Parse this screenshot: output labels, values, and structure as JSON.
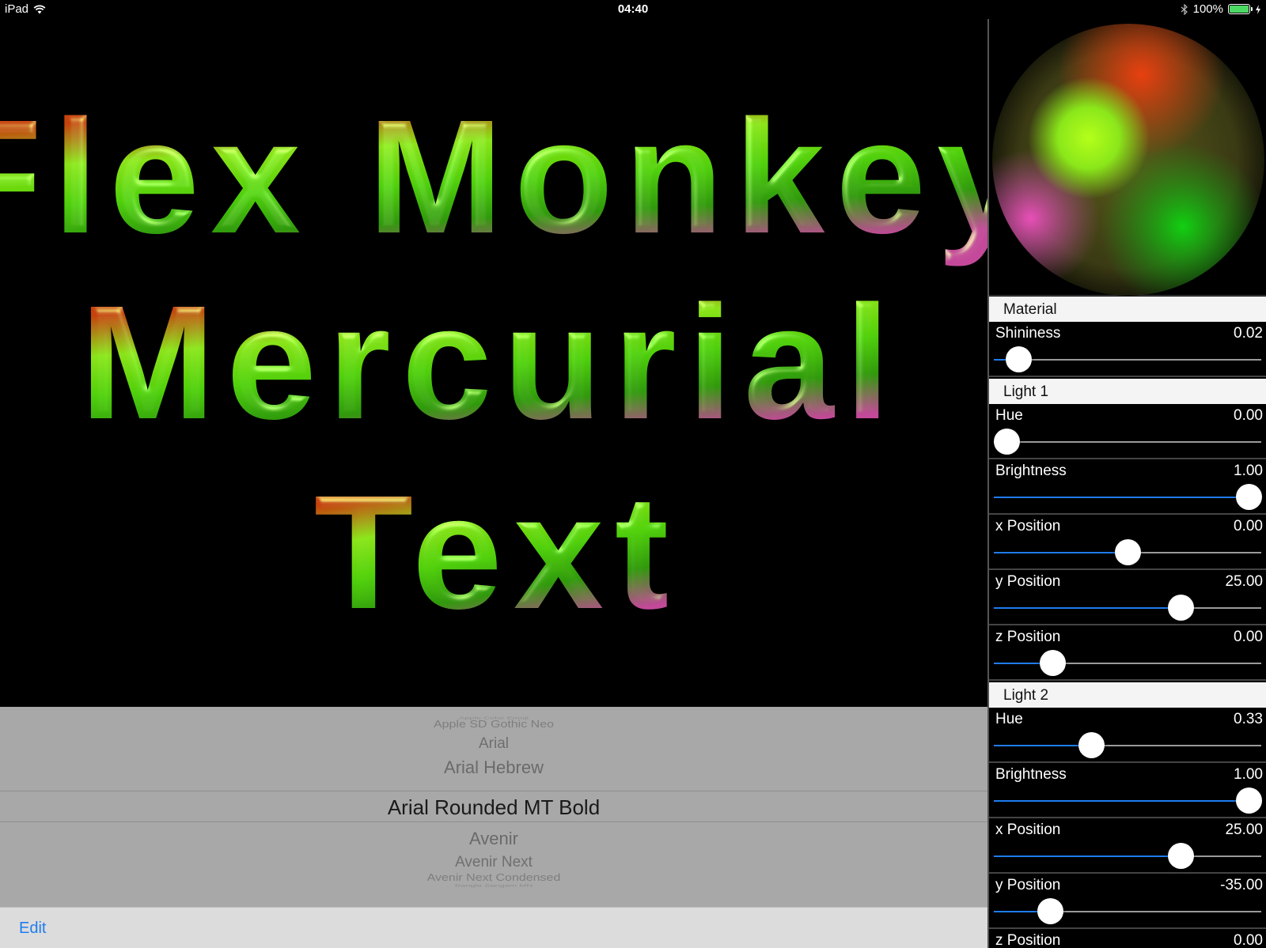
{
  "status_bar": {
    "device": "iPad",
    "time": "04:40",
    "battery": "100%"
  },
  "stage": {
    "lines": [
      "Flex Monkey",
      "Mercurial",
      "Text"
    ]
  },
  "picker": {
    "items": [
      "Apple Color Emoji",
      "Apple SD Gothic Neo",
      "Arial",
      "Arial Hebrew",
      "Arial Rounded MT Bold",
      "Avenir",
      "Avenir Next",
      "Avenir Next Condensed",
      "Bangla Sangam MN"
    ],
    "selected": "Arial Rounded MT Bold"
  },
  "toolbar": {
    "edit_label": "Edit"
  },
  "panel": {
    "material": {
      "header": "Material",
      "shininess": {
        "label": "Shininess",
        "value": "0.02",
        "fraction": 0.05
      }
    },
    "light1": {
      "header": "Light 1",
      "hue": {
        "label": "Hue",
        "value": "0.00",
        "fraction": 0.0
      },
      "brightness": {
        "label": "Brightness",
        "value": "1.00",
        "fraction": 1.0
      },
      "x": {
        "label": "x Position",
        "value": "0.00",
        "fraction": 0.5
      },
      "y": {
        "label": "y Position",
        "value": "25.00",
        "fraction": 0.72
      },
      "z": {
        "label": "z Position",
        "value": "0.00",
        "fraction": 0.19
      }
    },
    "light2": {
      "header": "Light 2",
      "hue": {
        "label": "Hue",
        "value": "0.33",
        "fraction": 0.35
      },
      "brightness": {
        "label": "Brightness",
        "value": "1.00",
        "fraction": 1.0
      },
      "x": {
        "label": "x Position",
        "value": "25.00",
        "fraction": 0.72
      },
      "y": {
        "label": "y Position",
        "value": "-35.00",
        "fraction": 0.18
      },
      "z": {
        "label": "z Position",
        "value": "0.00"
      }
    }
  },
  "colors": {
    "accent": "#1e7cf0",
    "picker_bg": "#a8a8a8",
    "toolbar_bg": "#dcdcdc",
    "text_green": "#5fd60a",
    "text_red": "#d84a12",
    "text_pink": "#d04fa0"
  }
}
